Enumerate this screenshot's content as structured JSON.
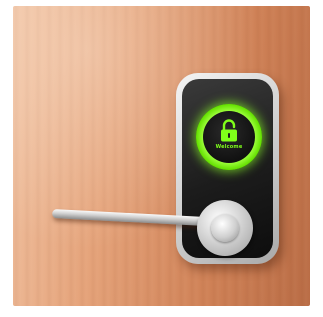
{
  "image": {
    "subject": "smart-door-lock",
    "lock": {
      "screen_text": "Welcome",
      "icon": "open-padlock-icon",
      "glow_color": "#7fff1a",
      "body_color": "#1c1c1c",
      "trim_color": "#d0d0d0"
    },
    "door_color": "#d98d62"
  }
}
